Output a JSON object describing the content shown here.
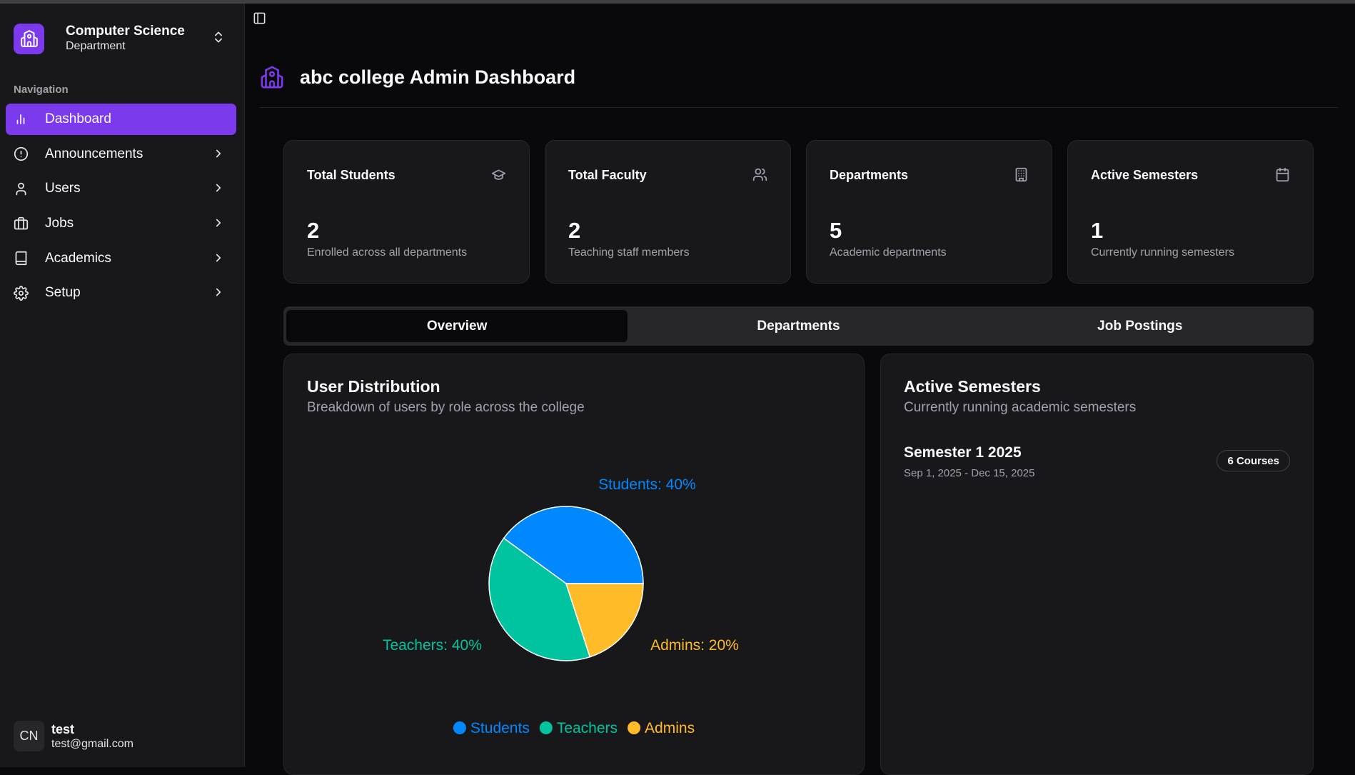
{
  "sidebar": {
    "brand": {
      "title": "Computer Science",
      "subtitle": "Department"
    },
    "nav_label": "Navigation",
    "items": [
      {
        "label": "Dashboard",
        "icon": "bar-chart-icon",
        "active": true
      },
      {
        "label": "Announcements",
        "icon": "alert-circle-icon"
      },
      {
        "label": "Users",
        "icon": "user-icon"
      },
      {
        "label": "Jobs",
        "icon": "briefcase-icon"
      },
      {
        "label": "Academics",
        "icon": "book-icon"
      },
      {
        "label": "Setup",
        "icon": "gear-icon"
      }
    ],
    "user": {
      "initials": "CN",
      "name": "test",
      "email": "test@gmail.com"
    }
  },
  "header": {
    "title": "abc college Admin Dashboard"
  },
  "stats": [
    {
      "title": "Total Students",
      "value": "2",
      "desc": "Enrolled across all departments",
      "icon": "graduation-cap-icon"
    },
    {
      "title": "Total Faculty",
      "value": "2",
      "desc": "Teaching staff members",
      "icon": "users-icon"
    },
    {
      "title": "Departments",
      "value": "5",
      "desc": "Academic departments",
      "icon": "building-icon"
    },
    {
      "title": "Active Semesters",
      "value": "1",
      "desc": "Currently running semesters",
      "icon": "calendar-icon"
    }
  ],
  "tabs": [
    {
      "label": "Overview",
      "active": true
    },
    {
      "label": "Departments"
    },
    {
      "label": "Job Postings"
    }
  ],
  "distribution": {
    "title": "User Distribution",
    "subtitle": "Breakdown of users by role across the college"
  },
  "chart_data": {
    "type": "pie",
    "categories": [
      "Students",
      "Teachers",
      "Admins"
    ],
    "values": [
      40,
      40,
      20
    ],
    "slice_labels": [
      "Students: 40%",
      "Teachers: 40%",
      "Admins: 20%"
    ],
    "colors": [
      "#0088fe",
      "#00c49f",
      "#ffbb28"
    ],
    "legend": "bottom"
  },
  "semesters": {
    "title": "Active Semesters",
    "subtitle": "Currently running academic semesters",
    "items": [
      {
        "name": "Semester 1 2025",
        "dates": "Sep 1, 2025 - Dec 15, 2025",
        "badge": "6 Courses"
      }
    ]
  },
  "colors": {
    "accent": "#7c3aed",
    "background": "#09090b",
    "card": "#18181b"
  }
}
